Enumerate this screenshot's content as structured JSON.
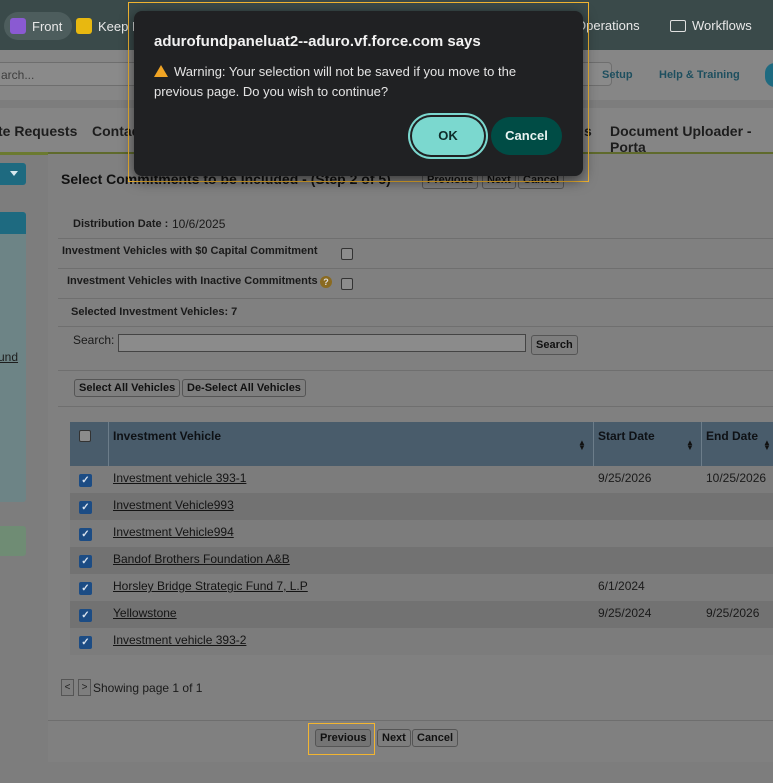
{
  "bookmarks": [
    {
      "label": "Front",
      "icon": "front-app-icon"
    },
    {
      "label": "Keep N",
      "icon": "keep-note-icon"
    },
    {
      "label": "Operations",
      "icon": "folder-icon"
    },
    {
      "label": "Workflows",
      "icon": "folder-icon"
    }
  ],
  "header": {
    "search_text": "arch...",
    "setup": "Setup",
    "help": "Help & Training"
  },
  "nav": {
    "items": [
      "te Requests",
      "Contac",
      "s",
      "Document Uploader - Porta"
    ]
  },
  "sidebar": {
    "link_fragment": "und"
  },
  "page": {
    "step_title": "Select Commitments to be Included - (Step 2 of 5)",
    "top_buttons": {
      "previous": "Previous",
      "next": "Next",
      "cancel": "Cancel"
    },
    "distribution_date_label": "Distribution Date :",
    "distribution_date": "10/6/2025",
    "zero_capital_label": "Investment Vehicles with $0 Capital Commitment",
    "inactive_label": "Investment Vehicles with Inactive Commitments",
    "selected_label": "Selected Investment Vehicles: 7",
    "search_label": "Search:",
    "search_button": "Search",
    "select_all": "Select All Vehicles",
    "deselect_all": "De-Select All Vehicles"
  },
  "table": {
    "columns": [
      "Investment Vehicle",
      "Start Date",
      "End Date"
    ],
    "rows": [
      {
        "name": "Investment vehicle 393-1",
        "start": "9/25/2026",
        "end": "10/25/2026"
      },
      {
        "name": "Investment Vehicle993",
        "start": "",
        "end": ""
      },
      {
        "name": "Investment Vehicle994",
        "start": "",
        "end": ""
      },
      {
        "name": "Bandof Brothers Foundation A&B",
        "start": "",
        "end": ""
      },
      {
        "name": "Horsley Bridge Strategic Fund 7, L.P",
        "start": "6/1/2024",
        "end": ""
      },
      {
        "name": "Yellowstone",
        "start": "9/25/2024",
        "end": "9/25/2026"
      },
      {
        "name": "Investment vehicle 393-2",
        "start": "",
        "end": ""
      }
    ]
  },
  "pagination": {
    "prev": "<",
    "next": ">",
    "text": "Showing page 1 of 1"
  },
  "footer": {
    "previous": "Previous",
    "next": "Next",
    "cancel": "Cancel"
  },
  "dialog": {
    "title": "adurofundpaneluat2--aduro.vf.force.com says",
    "message": "Warning: Your selection will not be saved if you move to the previous page. Do you wish to continue?",
    "ok": "OK",
    "cancel": "Cancel"
  },
  "colors": {
    "dialog_bg": "#202123",
    "ok_button": "#7bd8cf",
    "cancel_button": "#004c45",
    "focus_outline": "#f2b531"
  }
}
